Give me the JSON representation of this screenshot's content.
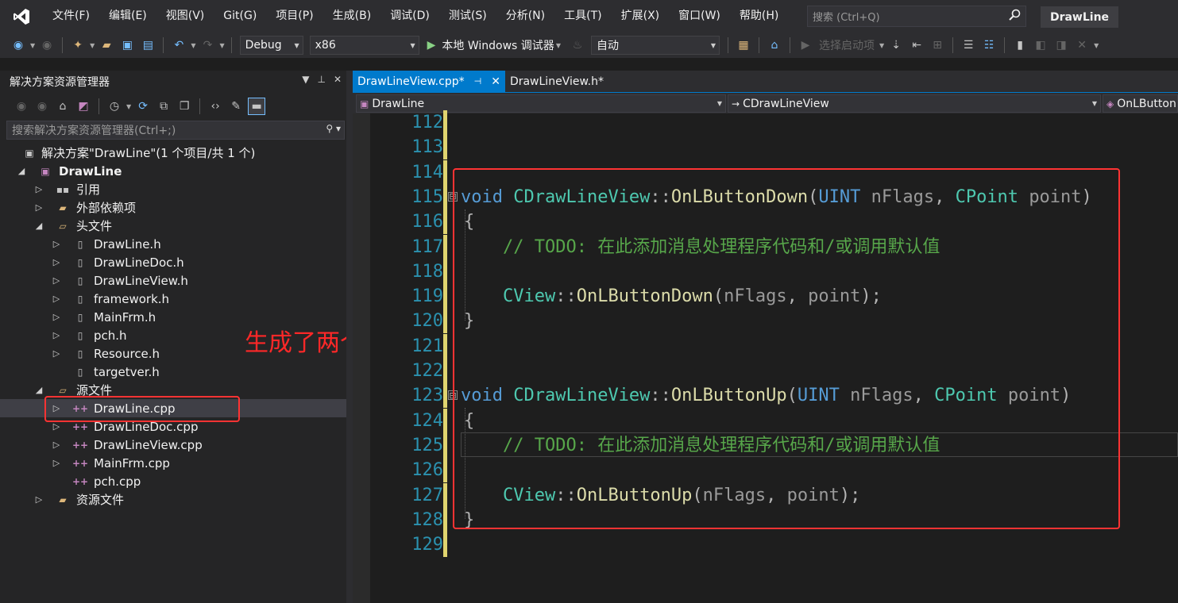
{
  "menubar": {
    "items": [
      "文件(F)",
      "编辑(E)",
      "视图(V)",
      "Git(G)",
      "项目(P)",
      "生成(B)",
      "调试(D)",
      "测试(S)",
      "分析(N)",
      "工具(T)",
      "扩展(X)",
      "窗口(W)",
      "帮助(H)"
    ],
    "search_placeholder": "搜索 (Ctrl+Q)",
    "solution_name": "DrawLine"
  },
  "toolbar": {
    "config": "Debug",
    "platform": "x86",
    "run_label": "本地 Windows 调试器",
    "auto": "自动",
    "startup_label": "选择启动项"
  },
  "solution_explorer": {
    "title": "解决方案资源管理器",
    "search_placeholder": "搜索解决方案资源管理器(Ctrl+;)",
    "tree": [
      {
        "label": "解决方案\"DrawLine\"(1 个项目/共 1 个)",
        "icon": "solution-icon",
        "level": 0,
        "expander": "none"
      },
      {
        "label": "DrawLine",
        "icon": "project-icon",
        "level": 0,
        "expander": "expanded",
        "bold": true
      },
      {
        "label": "引用",
        "icon": "references-icon",
        "level": 1,
        "expander": "collapsed"
      },
      {
        "label": "外部依赖项",
        "icon": "folder-icon",
        "level": 1,
        "expander": "collapsed"
      },
      {
        "label": "头文件",
        "icon": "folder-open-icon",
        "level": 1,
        "expander": "expanded"
      },
      {
        "label": "DrawLine.h",
        "icon": "header-file-icon",
        "level": 2,
        "expander": "collapsed"
      },
      {
        "label": "DrawLineDoc.h",
        "icon": "header-file-icon",
        "level": 2,
        "expander": "collapsed"
      },
      {
        "label": "DrawLineView.h",
        "icon": "header-file-icon",
        "level": 2,
        "expander": "collapsed"
      },
      {
        "label": "framework.h",
        "icon": "header-file-icon",
        "level": 2,
        "expander": "collapsed"
      },
      {
        "label": "MainFrm.h",
        "icon": "header-file-icon",
        "level": 2,
        "expander": "collapsed"
      },
      {
        "label": "pch.h",
        "icon": "header-file-icon",
        "level": 2,
        "expander": "collapsed"
      },
      {
        "label": "Resource.h",
        "icon": "header-file-icon",
        "level": 2,
        "expander": "collapsed"
      },
      {
        "label": "targetver.h",
        "icon": "header-file-icon",
        "level": 2,
        "expander": "none"
      },
      {
        "label": "源文件",
        "icon": "folder-open-icon",
        "level": 1,
        "expander": "expanded"
      },
      {
        "label": "DrawLine.cpp",
        "icon": "cpp-file-icon",
        "level": 2,
        "expander": "collapsed",
        "selected": true
      },
      {
        "label": "DrawLineDoc.cpp",
        "icon": "cpp-file-icon",
        "level": 2,
        "expander": "collapsed"
      },
      {
        "label": "DrawLineView.cpp",
        "icon": "cpp-file-icon",
        "level": 2,
        "expander": "collapsed"
      },
      {
        "label": "MainFrm.cpp",
        "icon": "cpp-file-icon",
        "level": 2,
        "expander": "collapsed"
      },
      {
        "label": "pch.cpp",
        "icon": "cpp-file-icon",
        "level": 2,
        "expander": "none"
      },
      {
        "label": "资源文件",
        "icon": "folder-icon",
        "level": 1,
        "expander": "collapsed"
      }
    ]
  },
  "annotation": {
    "text": "生成了两个函数"
  },
  "editor": {
    "tabs": [
      {
        "label": "DrawLineView.cpp*",
        "active": true
      },
      {
        "label": "DrawLineView.h*",
        "active": false
      }
    ],
    "nav": {
      "project": "DrawLine",
      "class": "CDrawLineView",
      "member": "OnLButtonDown(UINT nFlags, CPoint point)"
    },
    "lines": [
      {
        "num": "112",
        "fold": "",
        "tokens": []
      },
      {
        "num": "113",
        "fold": "",
        "tokens": []
      },
      {
        "num": "114",
        "fold": "",
        "tokens": []
      },
      {
        "num": "115",
        "fold": "⊟",
        "tokens": [
          [
            "kw",
            "void"
          ],
          [
            "pl",
            " "
          ],
          [
            "ty",
            "CDrawLineView"
          ],
          [
            "pl",
            "::"
          ],
          [
            "fn",
            "OnLButtonDown"
          ],
          [
            "pl",
            "("
          ],
          [
            "kw",
            "UINT"
          ],
          [
            "pl",
            " "
          ],
          [
            "pm",
            "nFlags"
          ],
          [
            "pl",
            ", "
          ],
          [
            "ty",
            "CPoint"
          ],
          [
            "pl",
            " "
          ],
          [
            "pm",
            "point"
          ],
          [
            "pl",
            ")"
          ]
        ]
      },
      {
        "num": "116",
        "fold": "",
        "tokens": [
          [
            "pl",
            "{"
          ]
        ]
      },
      {
        "num": "117",
        "fold": "",
        "tokens": [
          [
            "pl",
            "    "
          ],
          [
            "cm",
            "// TODO: 在此添加消息处理程序代码和/或调用默认值"
          ]
        ]
      },
      {
        "num": "118",
        "fold": "",
        "tokens": []
      },
      {
        "num": "119",
        "fold": "",
        "tokens": [
          [
            "pl",
            "    "
          ],
          [
            "ty",
            "CView"
          ],
          [
            "pl",
            "::"
          ],
          [
            "fn",
            "OnLButtonDown"
          ],
          [
            "pl",
            "("
          ],
          [
            "pm",
            "nFlags"
          ],
          [
            "pl",
            ", "
          ],
          [
            "pm",
            "point"
          ],
          [
            "pl",
            ");"
          ]
        ]
      },
      {
        "num": "120",
        "fold": "",
        "tokens": [
          [
            "pl",
            "}"
          ]
        ]
      },
      {
        "num": "121",
        "fold": "",
        "tokens": []
      },
      {
        "num": "122",
        "fold": "",
        "tokens": []
      },
      {
        "num": "123",
        "fold": "⊟",
        "tokens": [
          [
            "kw",
            "void"
          ],
          [
            "pl",
            " "
          ],
          [
            "ty",
            "CDrawLineView"
          ],
          [
            "pl",
            "::"
          ],
          [
            "fn",
            "OnLButtonUp"
          ],
          [
            "pl",
            "("
          ],
          [
            "kw",
            "UINT"
          ],
          [
            "pl",
            " "
          ],
          [
            "pm",
            "nFlags"
          ],
          [
            "pl",
            ", "
          ],
          [
            "ty",
            "CPoint"
          ],
          [
            "pl",
            " "
          ],
          [
            "pm",
            "point"
          ],
          [
            "pl",
            ")"
          ]
        ]
      },
      {
        "num": "124",
        "fold": "",
        "tokens": [
          [
            "pl",
            "{"
          ]
        ]
      },
      {
        "num": "125",
        "fold": "",
        "tokens": [
          [
            "pl",
            "    "
          ],
          [
            "cm",
            "// TODO: 在此添加消息处理程序代码和/或调用默认值"
          ]
        ]
      },
      {
        "num": "126",
        "fold": "",
        "tokens": []
      },
      {
        "num": "127",
        "fold": "",
        "tokens": [
          [
            "pl",
            "    "
          ],
          [
            "ty",
            "CView"
          ],
          [
            "pl",
            "::"
          ],
          [
            "fn",
            "OnLButtonUp"
          ],
          [
            "pl",
            "("
          ],
          [
            "pm",
            "nFlags"
          ],
          [
            "pl",
            ", "
          ],
          [
            "pm",
            "point"
          ],
          [
            "pl",
            ");"
          ]
        ]
      },
      {
        "num": "128",
        "fold": "",
        "tokens": [
          [
            "pl",
            "}"
          ]
        ]
      },
      {
        "num": "129",
        "fold": "",
        "tokens": []
      }
    ]
  },
  "colors": {
    "accent": "#007acc",
    "annotation": "#ff3333",
    "change_bar": "#e0d46f"
  }
}
